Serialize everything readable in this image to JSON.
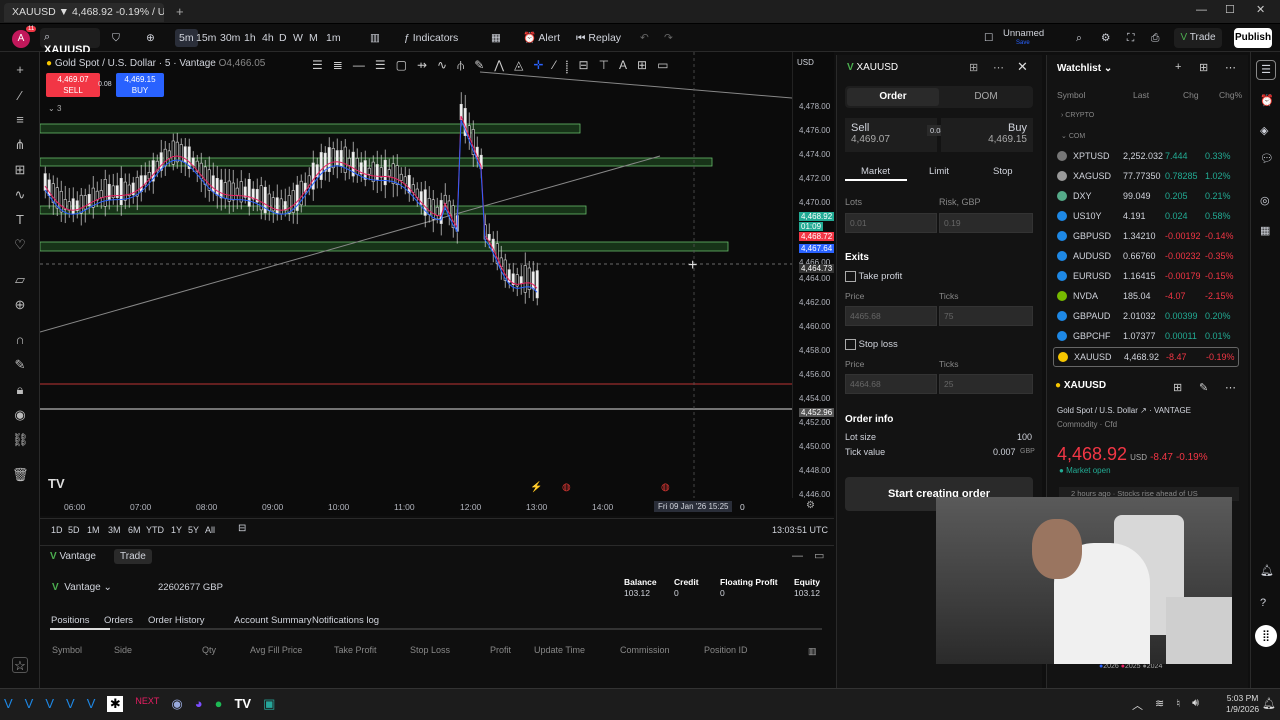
{
  "browser": {
    "tab_title": "XAUUSD ▼ 4,468.92 -0.19% / U",
    "new_tab": "+"
  },
  "toolbar": {
    "symbol": "XAUUSD",
    "intervals": [
      "5m",
      "15m",
      "30m",
      "1h",
      "4h",
      "D",
      "W",
      "M",
      "1m"
    ],
    "active_interval": "5m",
    "indicators": "Indicators",
    "alert": "Alert",
    "replay": "Replay",
    "layout_name": "Unnamed",
    "layout_sub": "Save",
    "trade": "Trade",
    "publish": "Publish",
    "avatar_badge": "11"
  },
  "chart": {
    "title": "Gold Spot / U.S. Dollar · 5 · Vantage",
    "ohlc_fragment": "O4,466.05",
    "sell_price": "4,469.07",
    "sell_label": "SELL",
    "spread": "0.08",
    "buy_price": "4,469.15",
    "buy_label": "BUY",
    "indicator_count": "3",
    "currency": "USD",
    "price_ticks": [
      "4,478.00",
      "4,476.00",
      "4,474.00",
      "4,472.00",
      "4,470.00",
      "4,468.92",
      "01:09",
      "4,468.72",
      "4,467.64",
      "4,466.00",
      "4,464.73",
      "4,464.00",
      "4,462.00",
      "4,460.00",
      "4,458.00",
      "4,456.00",
      "4,454.00",
      "4,452.96",
      "4,452.00",
      "4,450.00",
      "4,448.00",
      "4,446.00"
    ],
    "time_ticks": [
      "06:00",
      "07:00",
      "08:00",
      "09:00",
      "10:00",
      "11:00",
      "12:00",
      "13:00",
      "14:00"
    ],
    "crosshair_time": "Fri 09 Jan '26   15:25",
    "time_end": "0",
    "watermark": "TV"
  },
  "range": {
    "buttons": [
      "1D",
      "5D",
      "1M",
      "3M",
      "6M",
      "YTD",
      "1Y",
      "5Y",
      "All"
    ],
    "clock": "13:03:51 UTC"
  },
  "account": {
    "tabs": [
      "Vantage",
      "Trade"
    ],
    "broker": "Vantage",
    "account_id": "22602677 GBP",
    "stats": [
      {
        "label": "Balance",
        "value": "103.12"
      },
      {
        "label": "Credit",
        "value": "0"
      },
      {
        "label": "Floating Profit",
        "value": "0"
      },
      {
        "label": "Equity",
        "value": "103.12"
      }
    ],
    "subtabs": [
      "Positions",
      "Orders",
      "Order History",
      "Account Summary",
      "Notifications log"
    ],
    "columns": [
      "Symbol",
      "Side",
      "Qty",
      "Avg Fill Price",
      "Take Profit",
      "Stop Loss",
      "Profit",
      "Update Time",
      "Commission",
      "Position ID"
    ]
  },
  "order": {
    "symbol": "XAUUSD",
    "tabs": [
      "Order",
      "DOM"
    ],
    "sell_label": "Sell",
    "sell_price": "4,469.07",
    "spread": "0.08",
    "buy_label": "Buy",
    "buy_price": "4,469.15",
    "types": [
      "Market",
      "Limit",
      "Stop"
    ],
    "lots_label": "Lots",
    "lots_value": "0.01",
    "risk_label": "Risk, GBP",
    "risk_value": "0.19",
    "exits": "Exits",
    "take_profit": "Take profit",
    "stop_loss": "Stop loss",
    "price_label": "Price",
    "ticks_label": "Ticks",
    "tp_price": "4465.68",
    "tp_ticks": "75",
    "sl_price": "4464.68",
    "sl_ticks": "25",
    "order_info": "Order info",
    "lot_size_label": "Lot size",
    "lot_size": "100",
    "tick_value_label": "Tick value",
    "tick_value": "0.007",
    "tick_currency": "GBP",
    "start_button": "Start creating order"
  },
  "watchlist": {
    "title": "Watchlist",
    "headers": [
      "Symbol",
      "Last",
      "Chg",
      "Chg%"
    ],
    "groups": [
      "CRYPTO",
      "COM"
    ],
    "rows": [
      {
        "symbol": "XPTUSD",
        "last": "2,252.032",
        "chg": "7.444",
        "pct": "0.33%",
        "dir": "pos"
      },
      {
        "symbol": "XAGUSD",
        "last": "77.77350",
        "chg": "0.78285",
        "pct": "1.02%",
        "dir": "pos"
      },
      {
        "symbol": "DXY",
        "last": "99.049",
        "chg": "0.205",
        "pct": "0.21%",
        "dir": "pos"
      },
      {
        "symbol": "US10Y",
        "last": "4.191",
        "chg": "0.024",
        "pct": "0.58%",
        "dir": "pos"
      },
      {
        "symbol": "GBPUSD",
        "last": "1.34210",
        "chg": "-0.00192",
        "pct": "-0.14%",
        "dir": "neg"
      },
      {
        "symbol": "AUDUSD",
        "last": "0.66760",
        "chg": "-0.00232",
        "pct": "-0.35%",
        "dir": "neg"
      },
      {
        "symbol": "EURUSD",
        "last": "1.16415",
        "chg": "-0.00179",
        "pct": "-0.15%",
        "dir": "neg"
      },
      {
        "symbol": "NVDA",
        "last": "185.04",
        "chg": "-4.07",
        "pct": "-2.15%",
        "dir": "neg"
      },
      {
        "symbol": "GBPAUD",
        "last": "2.01032",
        "chg": "0.00399",
        "pct": "0.20%",
        "dir": "pos"
      },
      {
        "symbol": "GBPCHF",
        "last": "1.07377",
        "chg": "0.00011",
        "pct": "0.01%",
        "dir": "pos"
      },
      {
        "symbol": "XAUUSD",
        "last": "4,468.92",
        "chg": "-8.47",
        "pct": "-0.19%",
        "dir": "neg"
      }
    ],
    "detail": {
      "symbol": "XAUUSD",
      "name": "Gold Spot / U.S. Dollar",
      "exchange": "VANTAGE",
      "category": "Commodity · Cfd",
      "price": "4,468.92",
      "currency": "USD",
      "chg": "-8.47",
      "pct": "-0.19%",
      "status": "Market open",
      "news": "2 hours ago · Stocks rise ahead of US",
      "years": [
        "2026",
        "2025",
        "2024"
      ]
    }
  },
  "taskbar": {
    "time": "5:03 PM",
    "date": "1/9/2026"
  }
}
